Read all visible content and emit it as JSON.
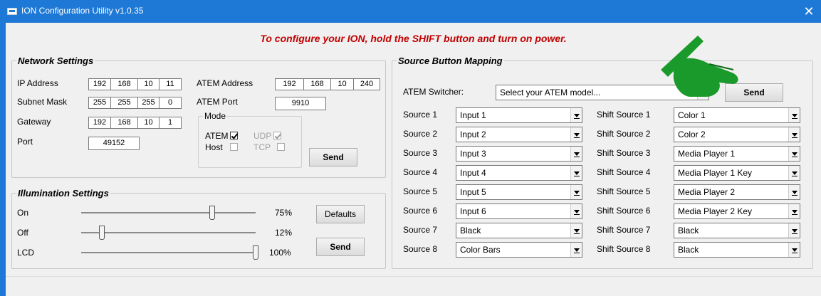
{
  "window": {
    "title": "ION Configuration Utility v1.0.35",
    "close": "✕"
  },
  "banner": "To configure your ION, hold the SHIFT button and turn on power.",
  "network": {
    "legend": "Network Settings",
    "ip_label": "IP Address",
    "ip": [
      "192",
      "168",
      "10",
      "11"
    ],
    "subnet_label": "Subnet Mask",
    "subnet": [
      "255",
      "255",
      "255",
      "0"
    ],
    "gateway_label": "Gateway",
    "gateway": [
      "192",
      "168",
      "10",
      "1"
    ],
    "port_label": "Port",
    "port": "49152",
    "atem_address_label": "ATEM Address",
    "atem_address": [
      "192",
      "168",
      "10",
      "240"
    ],
    "atem_port_label": "ATEM Port",
    "atem_port": "9910",
    "mode_legend": "Mode",
    "mode_atem": "ATEM",
    "mode_udp": "UDP",
    "mode_host": "Host",
    "mode_tcp": "TCP",
    "send": "Send"
  },
  "illumination": {
    "legend": "Illumination Settings",
    "rows": [
      {
        "label": "On",
        "value": "75%",
        "level": 0.75
      },
      {
        "label": "Off",
        "value": "12%",
        "level": 0.12
      },
      {
        "label": "LCD",
        "value": "100%",
        "level": 1.0
      }
    ],
    "defaults": "Defaults",
    "send": "Send"
  },
  "mapping": {
    "legend": "Source Button Mapping",
    "switcher_label": "ATEM Switcher:",
    "switcher_value": "Select your ATEM model...",
    "send": "Send",
    "sources": [
      {
        "label": "Source 1",
        "value": "Input 1"
      },
      {
        "label": "Source 2",
        "value": "Input 2"
      },
      {
        "label": "Source 3",
        "value": "Input 3"
      },
      {
        "label": "Source 4",
        "value": "Input 4"
      },
      {
        "label": "Source 5",
        "value": "Input 5"
      },
      {
        "label": "Source 6",
        "value": "Input 6"
      },
      {
        "label": "Source 7",
        "value": "Black"
      },
      {
        "label": "Source 8",
        "value": "Color Bars"
      }
    ],
    "shift_sources": [
      {
        "label": "Shift Source 1",
        "value": "Color 1"
      },
      {
        "label": "Shift Source 2",
        "value": "Color 2"
      },
      {
        "label": "Shift Source 3",
        "value": "Media Player 1"
      },
      {
        "label": "Shift Source 4",
        "value": "Media Player 1 Key"
      },
      {
        "label": "Shift Source 5",
        "value": "Media Player 2"
      },
      {
        "label": "Shift Source 6",
        "value": "Media Player 2 Key"
      },
      {
        "label": "Shift Source 7",
        "value": "Black"
      },
      {
        "label": "Shift Source 8",
        "value": "Black"
      }
    ]
  },
  "colors": {
    "titlebar": "#1e78d6",
    "banner": "#c00000",
    "pointer": "#1a9a2a"
  },
  "icons": {
    "pointer": "pointing-hand-icon"
  }
}
